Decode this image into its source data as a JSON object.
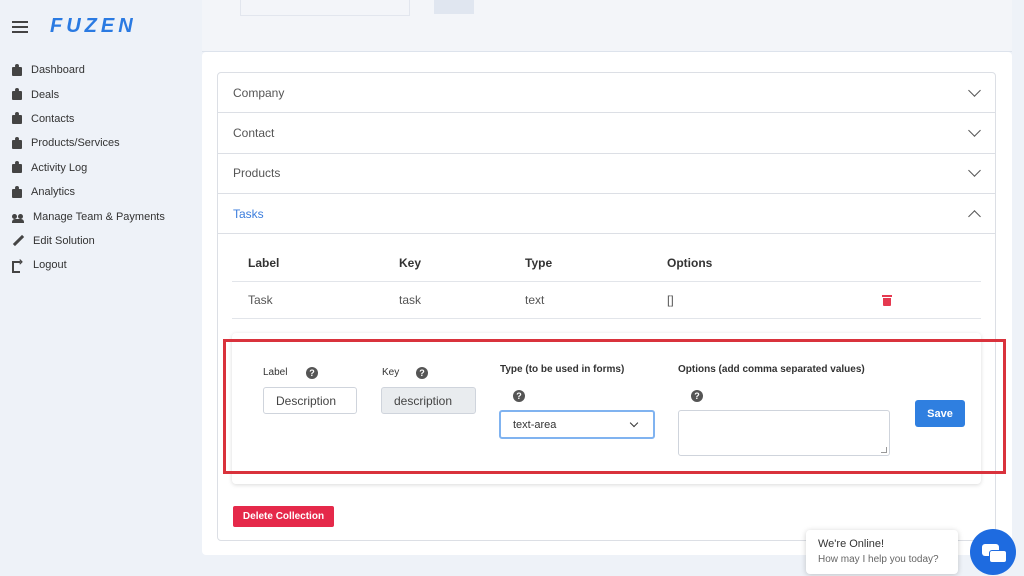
{
  "app": {
    "logo": "FUZEN"
  },
  "sidebar": {
    "items": [
      {
        "label": "Dashboard",
        "icon": "puzzle-icon"
      },
      {
        "label": "Deals",
        "icon": "puzzle-icon"
      },
      {
        "label": "Contacts",
        "icon": "puzzle-icon"
      },
      {
        "label": "Products/Services",
        "icon": "puzzle-icon"
      },
      {
        "label": "Activity Log",
        "icon": "puzzle-icon"
      },
      {
        "label": "Analytics",
        "icon": "puzzle-icon"
      },
      {
        "label": "Manage Team & Payments",
        "icon": "team-icon"
      },
      {
        "label": "Edit Solution",
        "icon": "pencil-icon"
      },
      {
        "label": "Logout",
        "icon": "logout-icon"
      }
    ]
  },
  "accordion": {
    "sections": [
      {
        "label": "Company",
        "expanded": false
      },
      {
        "label": "Contact",
        "expanded": false
      },
      {
        "label": "Products",
        "expanded": false
      },
      {
        "label": "Tasks",
        "expanded": true
      }
    ]
  },
  "table": {
    "headers": [
      "Label",
      "Key",
      "Type",
      "Options"
    ],
    "rows": [
      {
        "label": "Task",
        "key": "task",
        "type": "text",
        "options": "[]"
      }
    ]
  },
  "form": {
    "label_title": "Label",
    "key_title": "Key",
    "type_title": "Type (to be used in forms)",
    "options_title": "Options (add comma separated values)",
    "help_glyph": "?",
    "label_value": "Description",
    "key_value": "description",
    "type_value": "text-area",
    "options_value": "",
    "save_label": "Save"
  },
  "delete_collection_label": "Delete Collection",
  "chat": {
    "title": "We're Online!",
    "subtitle": "How may I help you today?"
  },
  "colors": {
    "brand": "#2a7ae2",
    "active_section": "#3b7ddd",
    "save_button": "#2f7fe0",
    "danger": "#e5294a",
    "highlight_border": "#d9323c",
    "chat_button": "#1e6be0"
  }
}
